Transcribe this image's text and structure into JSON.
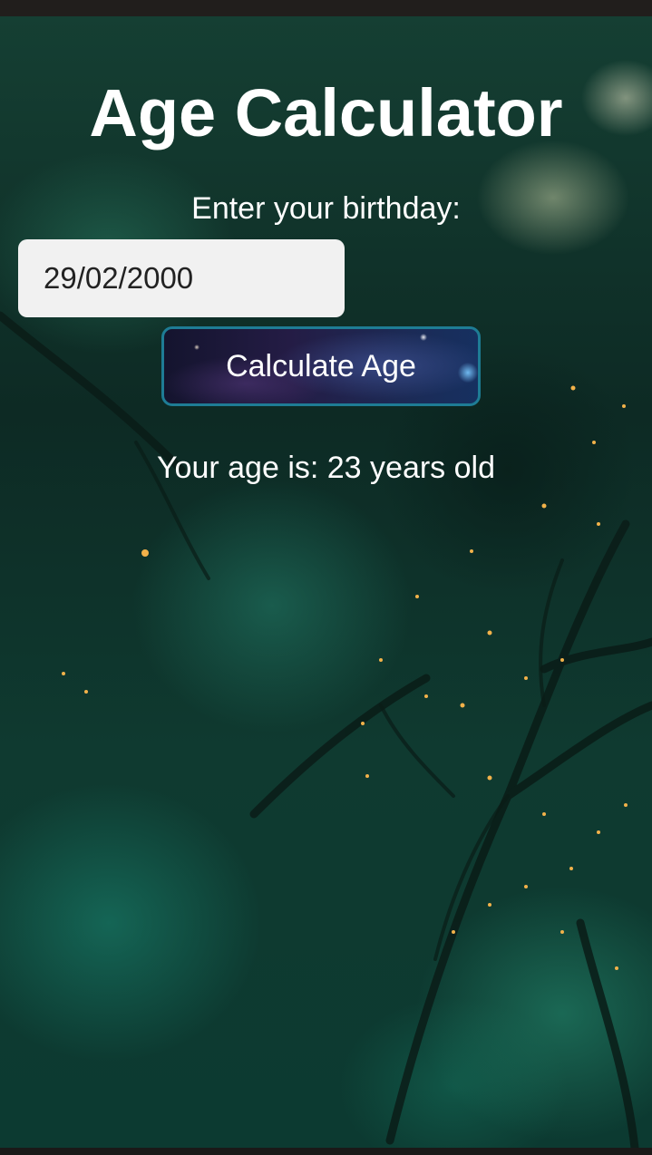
{
  "app": {
    "title": "Age Calculator"
  },
  "form": {
    "prompt": "Enter your birthday:",
    "birthday_value": "29/02/2000",
    "calculate_label": "Calculate Age"
  },
  "result": {
    "text": "Your age is: 23 years old"
  },
  "colors": {
    "text": "#ffffff",
    "input_background": "#f1f1f1",
    "button_border": "#1e7c95",
    "background_dominant": "#0f3a30"
  }
}
